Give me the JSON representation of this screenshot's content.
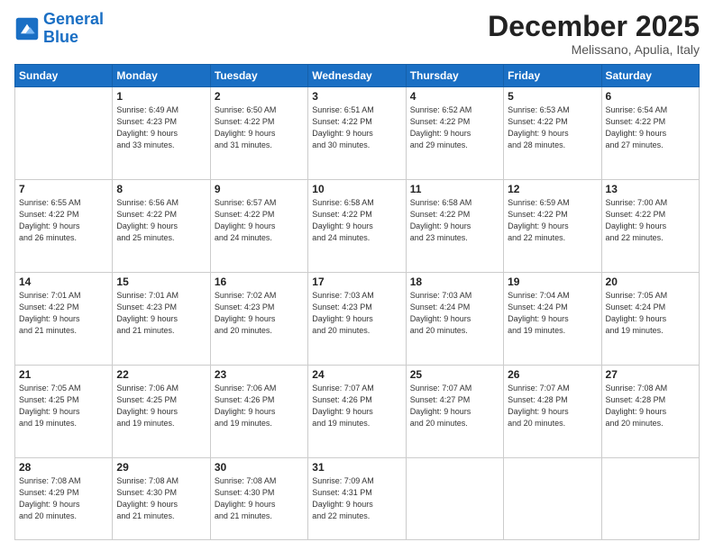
{
  "logo": {
    "line1": "General",
    "line2": "Blue"
  },
  "header": {
    "month": "December 2025",
    "location": "Melissano, Apulia, Italy"
  },
  "weekdays": [
    "Sunday",
    "Monday",
    "Tuesday",
    "Wednesday",
    "Thursday",
    "Friday",
    "Saturday"
  ],
  "weeks": [
    [
      {
        "day": "",
        "info": ""
      },
      {
        "day": "1",
        "info": "Sunrise: 6:49 AM\nSunset: 4:23 PM\nDaylight: 9 hours\nand 33 minutes."
      },
      {
        "day": "2",
        "info": "Sunrise: 6:50 AM\nSunset: 4:22 PM\nDaylight: 9 hours\nand 31 minutes."
      },
      {
        "day": "3",
        "info": "Sunrise: 6:51 AM\nSunset: 4:22 PM\nDaylight: 9 hours\nand 30 minutes."
      },
      {
        "day": "4",
        "info": "Sunrise: 6:52 AM\nSunset: 4:22 PM\nDaylight: 9 hours\nand 29 minutes."
      },
      {
        "day": "5",
        "info": "Sunrise: 6:53 AM\nSunset: 4:22 PM\nDaylight: 9 hours\nand 28 minutes."
      },
      {
        "day": "6",
        "info": "Sunrise: 6:54 AM\nSunset: 4:22 PM\nDaylight: 9 hours\nand 27 minutes."
      }
    ],
    [
      {
        "day": "7",
        "info": "Sunrise: 6:55 AM\nSunset: 4:22 PM\nDaylight: 9 hours\nand 26 minutes."
      },
      {
        "day": "8",
        "info": "Sunrise: 6:56 AM\nSunset: 4:22 PM\nDaylight: 9 hours\nand 25 minutes."
      },
      {
        "day": "9",
        "info": "Sunrise: 6:57 AM\nSunset: 4:22 PM\nDaylight: 9 hours\nand 24 minutes."
      },
      {
        "day": "10",
        "info": "Sunrise: 6:58 AM\nSunset: 4:22 PM\nDaylight: 9 hours\nand 24 minutes."
      },
      {
        "day": "11",
        "info": "Sunrise: 6:58 AM\nSunset: 4:22 PM\nDaylight: 9 hours\nand 23 minutes."
      },
      {
        "day": "12",
        "info": "Sunrise: 6:59 AM\nSunset: 4:22 PM\nDaylight: 9 hours\nand 22 minutes."
      },
      {
        "day": "13",
        "info": "Sunrise: 7:00 AM\nSunset: 4:22 PM\nDaylight: 9 hours\nand 22 minutes."
      }
    ],
    [
      {
        "day": "14",
        "info": "Sunrise: 7:01 AM\nSunset: 4:22 PM\nDaylight: 9 hours\nand 21 minutes."
      },
      {
        "day": "15",
        "info": "Sunrise: 7:01 AM\nSunset: 4:23 PM\nDaylight: 9 hours\nand 21 minutes."
      },
      {
        "day": "16",
        "info": "Sunrise: 7:02 AM\nSunset: 4:23 PM\nDaylight: 9 hours\nand 20 minutes."
      },
      {
        "day": "17",
        "info": "Sunrise: 7:03 AM\nSunset: 4:23 PM\nDaylight: 9 hours\nand 20 minutes."
      },
      {
        "day": "18",
        "info": "Sunrise: 7:03 AM\nSunset: 4:24 PM\nDaylight: 9 hours\nand 20 minutes."
      },
      {
        "day": "19",
        "info": "Sunrise: 7:04 AM\nSunset: 4:24 PM\nDaylight: 9 hours\nand 19 minutes."
      },
      {
        "day": "20",
        "info": "Sunrise: 7:05 AM\nSunset: 4:24 PM\nDaylight: 9 hours\nand 19 minutes."
      }
    ],
    [
      {
        "day": "21",
        "info": "Sunrise: 7:05 AM\nSunset: 4:25 PM\nDaylight: 9 hours\nand 19 minutes."
      },
      {
        "day": "22",
        "info": "Sunrise: 7:06 AM\nSunset: 4:25 PM\nDaylight: 9 hours\nand 19 minutes."
      },
      {
        "day": "23",
        "info": "Sunrise: 7:06 AM\nSunset: 4:26 PM\nDaylight: 9 hours\nand 19 minutes."
      },
      {
        "day": "24",
        "info": "Sunrise: 7:07 AM\nSunset: 4:26 PM\nDaylight: 9 hours\nand 19 minutes."
      },
      {
        "day": "25",
        "info": "Sunrise: 7:07 AM\nSunset: 4:27 PM\nDaylight: 9 hours\nand 20 minutes."
      },
      {
        "day": "26",
        "info": "Sunrise: 7:07 AM\nSunset: 4:28 PM\nDaylight: 9 hours\nand 20 minutes."
      },
      {
        "day": "27",
        "info": "Sunrise: 7:08 AM\nSunset: 4:28 PM\nDaylight: 9 hours\nand 20 minutes."
      }
    ],
    [
      {
        "day": "28",
        "info": "Sunrise: 7:08 AM\nSunset: 4:29 PM\nDaylight: 9 hours\nand 20 minutes."
      },
      {
        "day": "29",
        "info": "Sunrise: 7:08 AM\nSunset: 4:30 PM\nDaylight: 9 hours\nand 21 minutes."
      },
      {
        "day": "30",
        "info": "Sunrise: 7:08 AM\nSunset: 4:30 PM\nDaylight: 9 hours\nand 21 minutes."
      },
      {
        "day": "31",
        "info": "Sunrise: 7:09 AM\nSunset: 4:31 PM\nDaylight: 9 hours\nand 22 minutes."
      },
      {
        "day": "",
        "info": ""
      },
      {
        "day": "",
        "info": ""
      },
      {
        "day": "",
        "info": ""
      }
    ]
  ]
}
